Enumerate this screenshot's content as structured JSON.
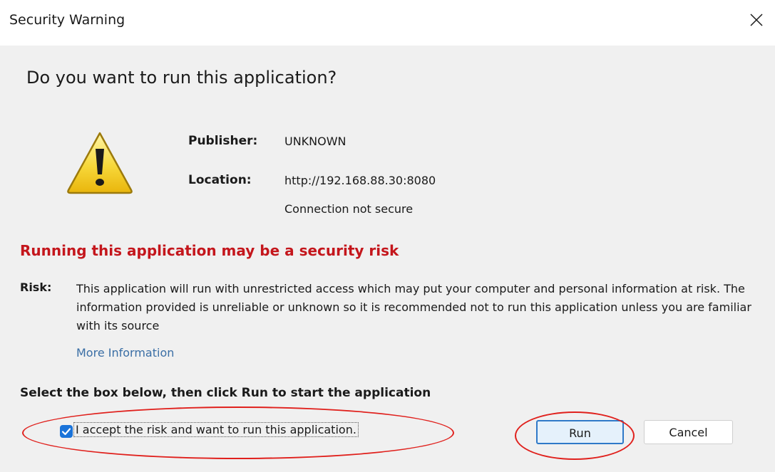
{
  "window": {
    "title": "Security Warning"
  },
  "dialog": {
    "headline": "Do you want to run this application?",
    "publisher_label": "Publisher:",
    "publisher_value": "UNKNOWN",
    "location_label": "Location:",
    "location_value": "http://192.168.88.30:8080",
    "connection_status": "Connection not secure",
    "risk_heading": "Running this application may be a security risk",
    "risk_label": "Risk:",
    "risk_text": "This application will run with unrestricted access which may put your computer and personal information at risk. The information provided is unreliable or unknown so it is recommended not to run this application unless you are familiar with its source",
    "more_info_link": "More Information",
    "select_instruction": "Select the box below, then click Run to start the application",
    "checkbox_label": "I accept the risk and want to run this application.",
    "checkbox_checked": true
  },
  "buttons": {
    "run_label": "Run",
    "cancel_label": "Cancel"
  },
  "icons": {
    "warning": "warning-triangle-icon",
    "close": "close-icon",
    "checkmark": "checkmark-icon"
  },
  "colors": {
    "risk_heading": "#c4161c",
    "link": "#3a6ea5",
    "accent": "#1a73d9",
    "annotation": "#e0201c"
  }
}
